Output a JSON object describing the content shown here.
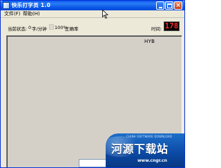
{
  "window": {
    "title": "快乐打字员 1.0"
  },
  "menu": {
    "file_label": "文件(F)",
    "help_label": "帮助(H)"
  },
  "status": {
    "status_label": "当前状态:",
    "speed_value": "0",
    "speed_unit": "字/分钟",
    "accuracy_value": "100%",
    "accuracy_label": "正确率",
    "time_label": "时间:",
    "time_value": "178"
  },
  "typing_area": {
    "falling_word": "HYB"
  },
  "input": {
    "value": ""
  },
  "watermark": {
    "tagline": "CHINA SOFTWARE DOWNLOAD",
    "title": "河源下载站",
    "url": "www.cngr.cn"
  },
  "colors": {
    "titlebar": "#0a5bee",
    "window_bg": "#ece9d8",
    "timer_bg": "#000000",
    "timer_digits": "#ff2a2a",
    "typing_area_bg": "#d4d0c8",
    "watermark_bg": "#0b4aa6"
  },
  "icons": {
    "app": "app-icon",
    "minimize": "minimize-icon",
    "maximize": "maximize-icon",
    "close": "close-icon",
    "cursor": "mouse-cursor-icon"
  }
}
